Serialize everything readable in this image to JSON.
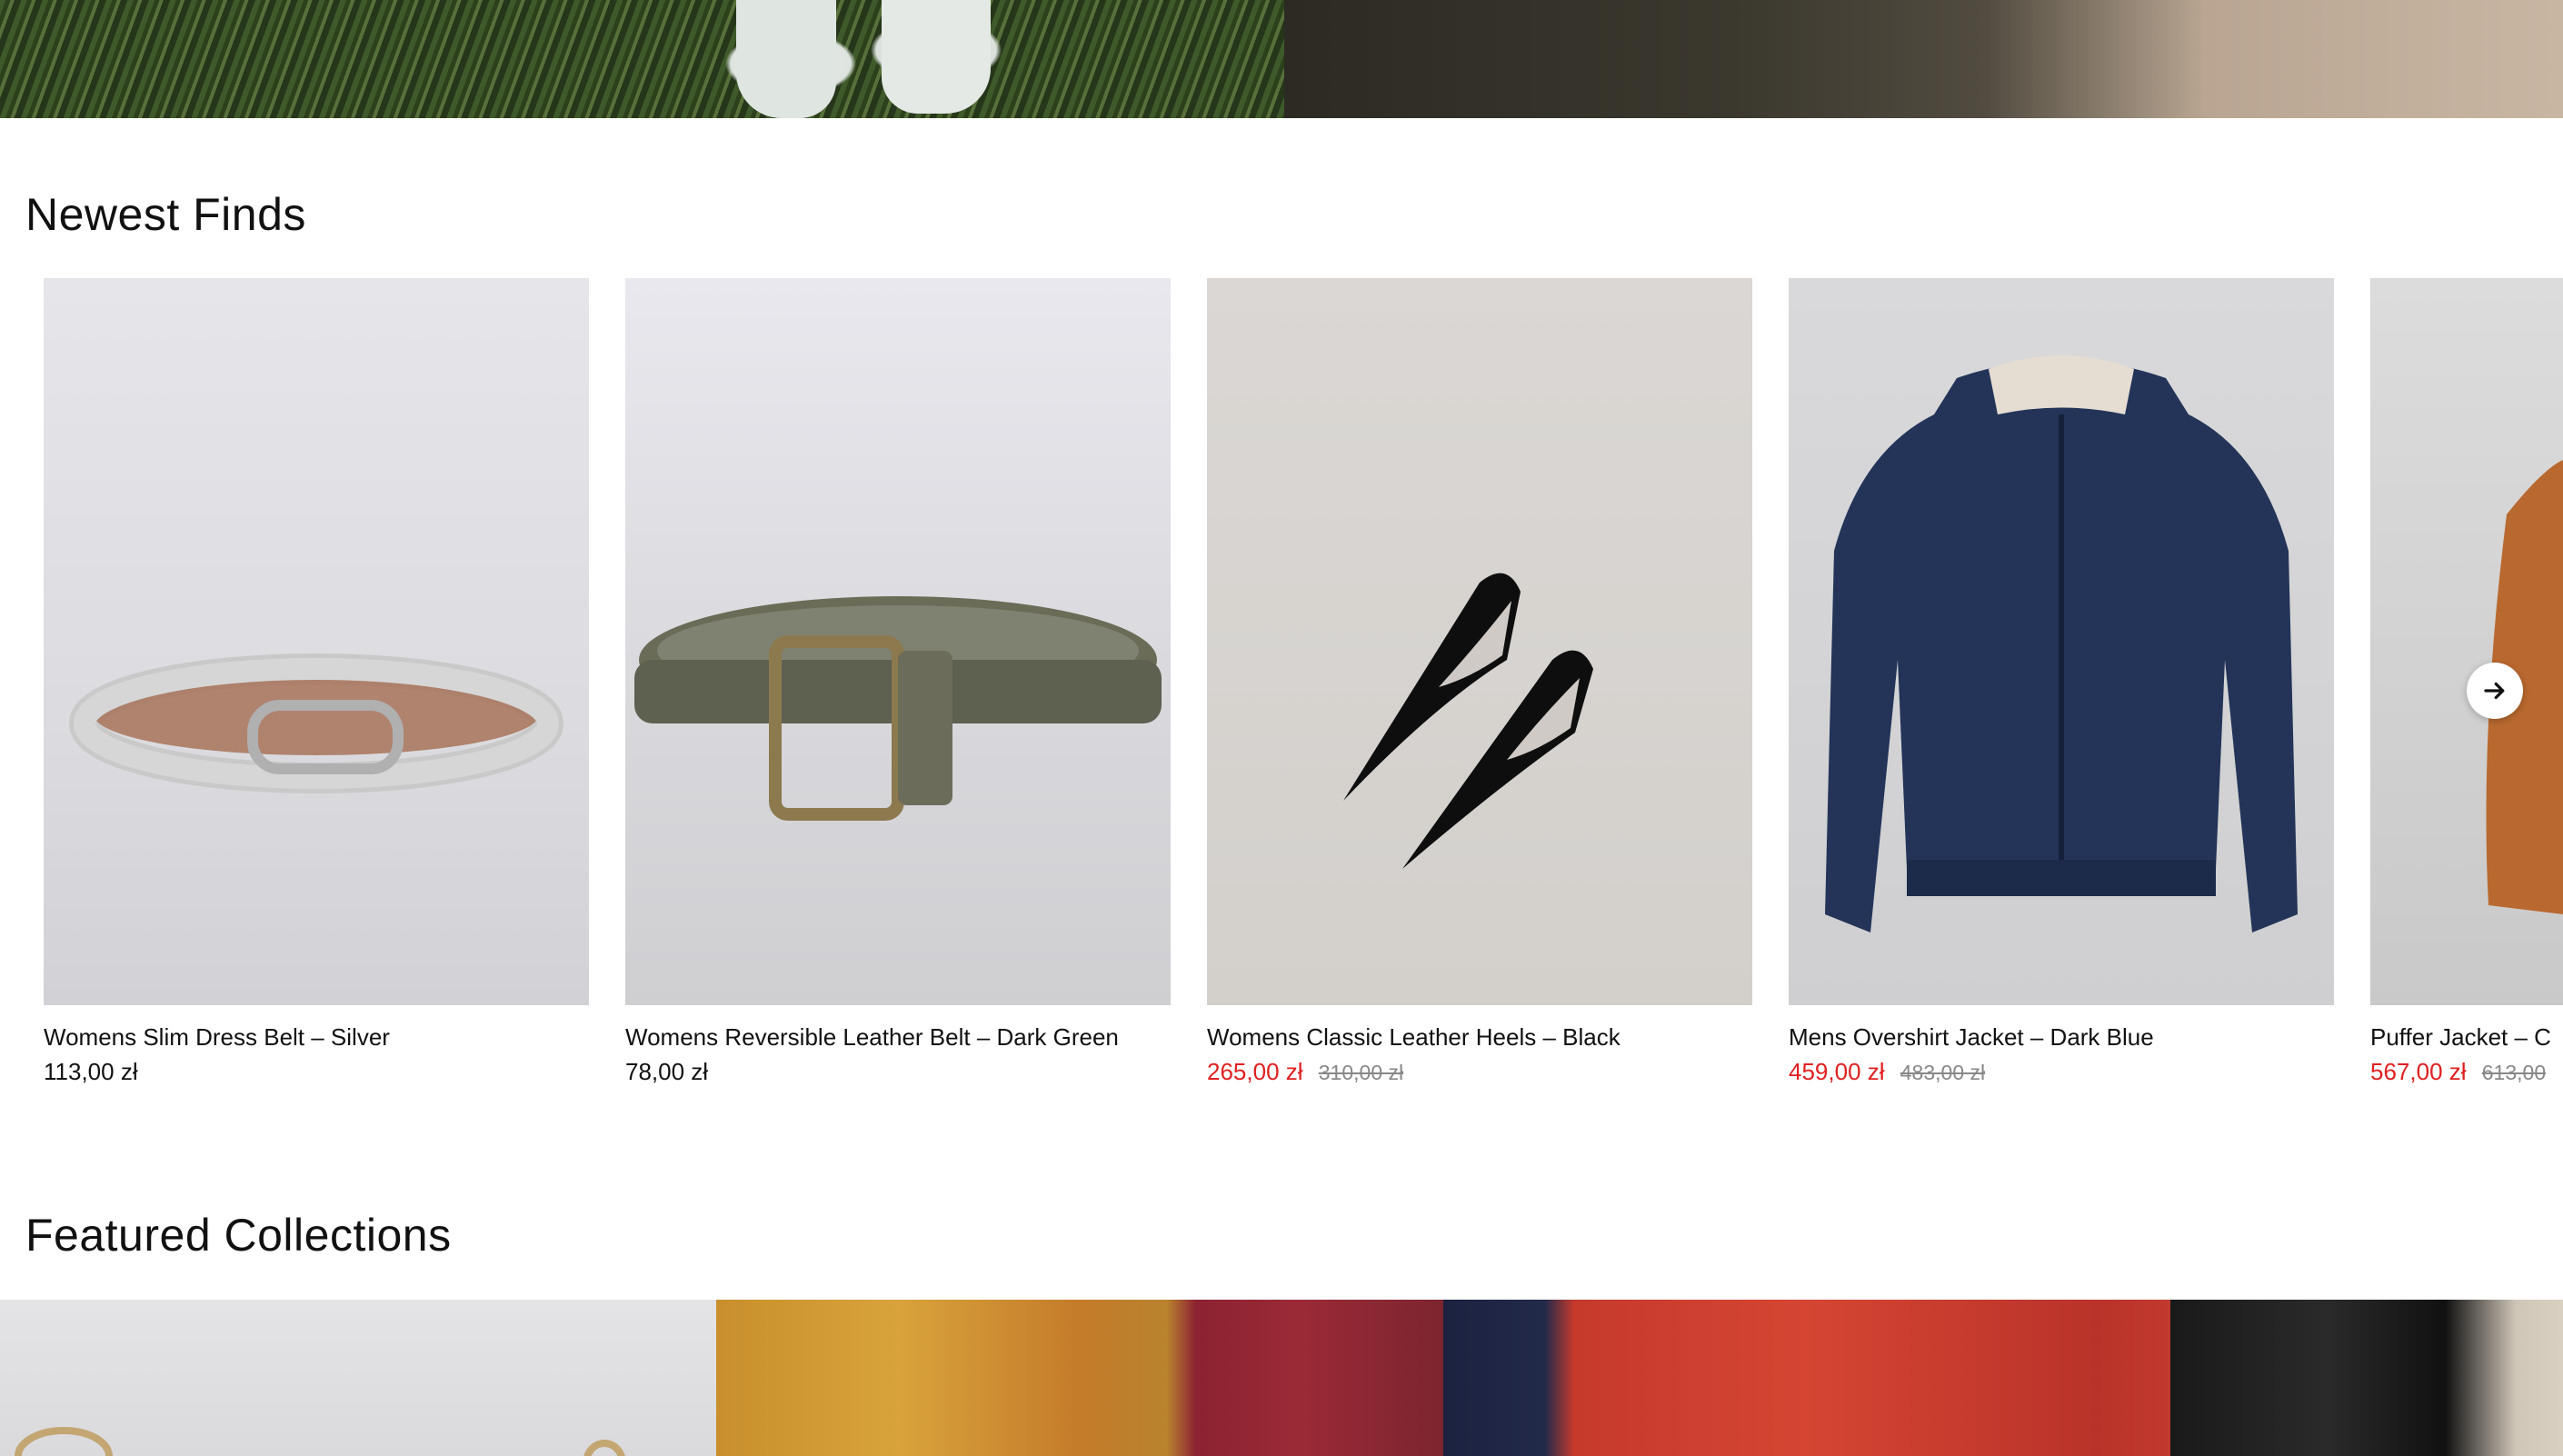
{
  "newest": {
    "title": "Newest Finds",
    "next_icon": "arrow-right-icon",
    "products": [
      {
        "name": "Womens Slim Dress Belt – Silver",
        "price": "113,00 zł",
        "sale_price": "",
        "old_price": ""
      },
      {
        "name": "Womens Reversible Leather Belt – Dark Green",
        "price": "78,00 zł",
        "sale_price": "",
        "old_price": ""
      },
      {
        "name": "Womens Classic Leather Heels – Black",
        "price": "",
        "sale_price": "265,00 zł",
        "old_price": "310,00 zł"
      },
      {
        "name": "Mens Overshirt Jacket – Dark Blue",
        "price": "",
        "sale_price": "459,00 zł",
        "old_price": "483,00 zł"
      },
      {
        "name": "Puffer Jacket – C",
        "price": "",
        "sale_price": "567,00 zł",
        "old_price": "613,00"
      }
    ]
  },
  "featured": {
    "title": "Featured Collections"
  },
  "colors": {
    "sale": "#e02020",
    "old_price": "#888888",
    "text": "#111111",
    "background": "#ffffff"
  }
}
